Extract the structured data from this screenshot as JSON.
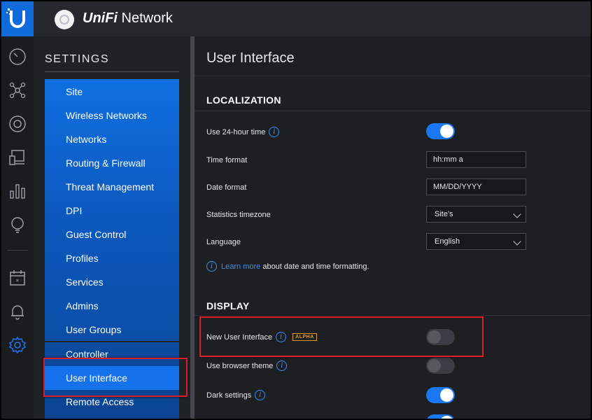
{
  "app": {
    "name_prefix": "UniFi",
    "name_suffix": " Network"
  },
  "rail": {
    "icons": [
      "unifi-logo-icon",
      "dashboard-icon",
      "topology-icon",
      "devices-icon",
      "clients-icon",
      "statistics-icon",
      "insights-icon",
      "events-icon",
      "alerts-icon",
      "settings-icon"
    ]
  },
  "settings": {
    "title": "SETTINGS",
    "items": [
      {
        "label": "Site"
      },
      {
        "label": "Wireless Networks"
      },
      {
        "label": "Networks"
      },
      {
        "label": "Routing & Firewall"
      },
      {
        "label": "Threat Management"
      },
      {
        "label": "DPI"
      },
      {
        "label": "Guest Control"
      },
      {
        "label": "Profiles"
      },
      {
        "label": "Services"
      },
      {
        "label": "Admins"
      },
      {
        "label": "User Groups"
      }
    ],
    "lower_items": [
      {
        "label": "Controller"
      },
      {
        "label": "User Interface"
      },
      {
        "label": "Remote Access"
      }
    ]
  },
  "page": {
    "title": "User Interface",
    "localization": {
      "title": "LOCALIZATION",
      "use24h_label": "Use 24-hour time",
      "use24h_on": true,
      "time_format_label": "Time format",
      "time_format_value": "hh:mm a",
      "date_format_label": "Date format",
      "date_format_value": "MM/DD/YYYY",
      "timezone_label": "Statistics timezone",
      "timezone_value": "Site's",
      "language_label": "Language",
      "language_value": "English",
      "help_link": "Learn more",
      "help_text": "about date and time formatting."
    },
    "display": {
      "title": "DISPLAY",
      "new_ui_label": "New User Interface",
      "new_ui_badge": "ALPHA",
      "new_ui_on": false,
      "browser_theme_label": "Use browser theme",
      "browser_theme_on": false,
      "dark_settings_label": "Dark settings",
      "dark_settings_on": true
    }
  },
  "colors": {
    "accent": "#1a78f2",
    "highlight": "#d92027",
    "badge": "#e59a1f"
  }
}
